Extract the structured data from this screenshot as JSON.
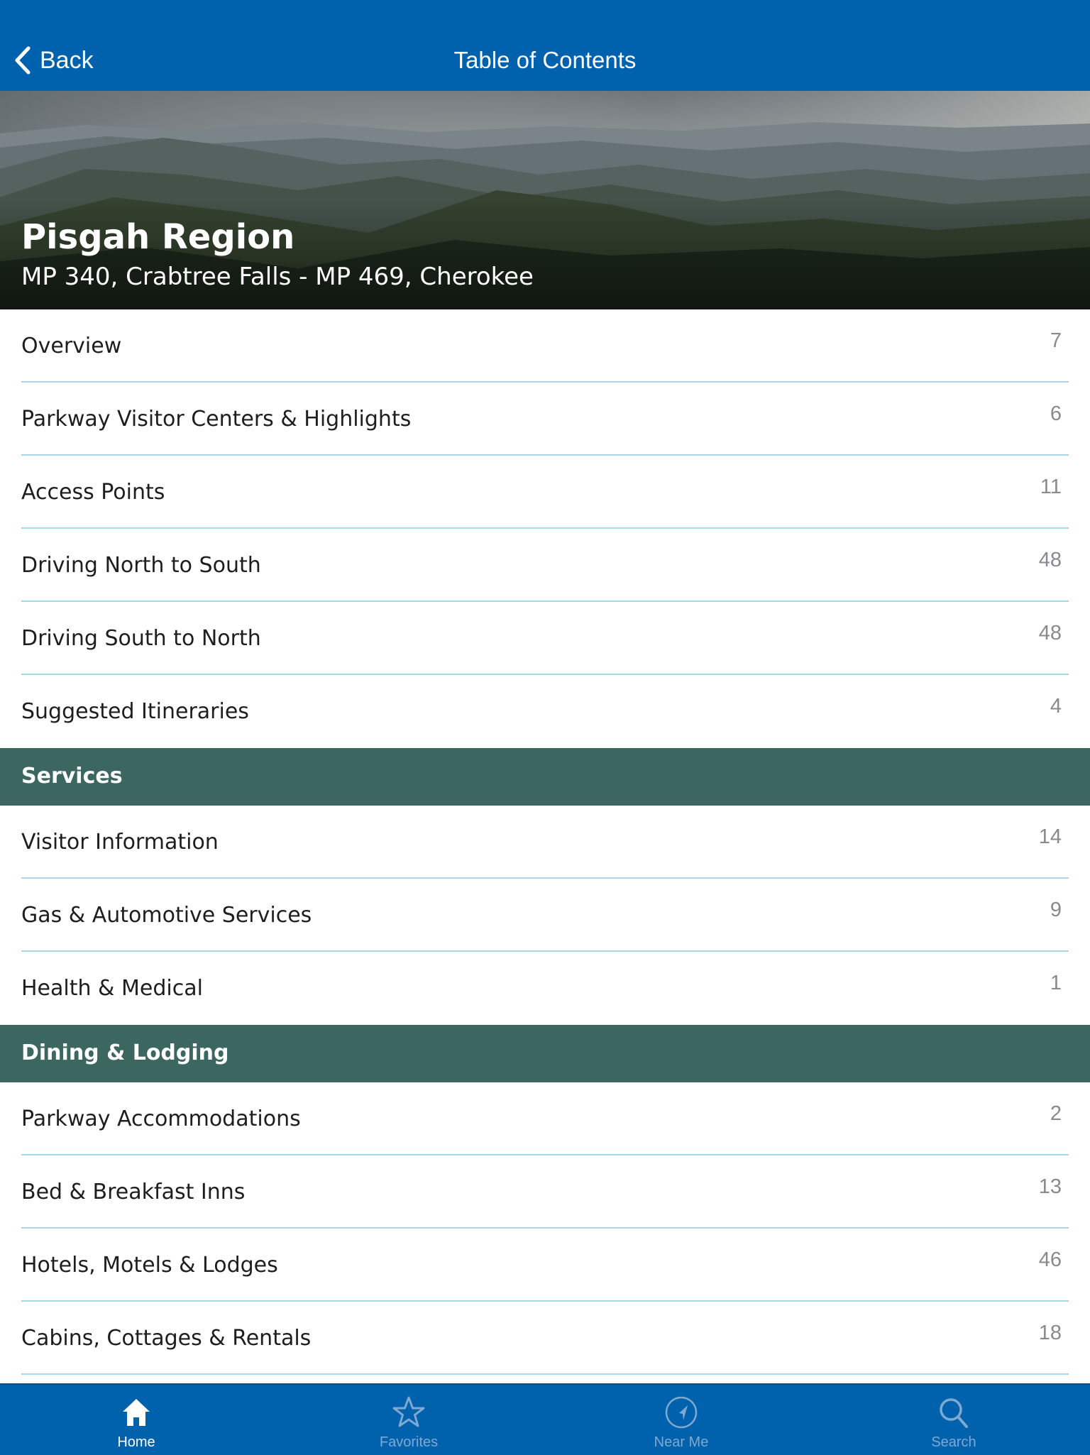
{
  "navbar": {
    "back_label": "Back",
    "title": "Table of Contents"
  },
  "hero": {
    "title": "Pisgah Region",
    "subtitle": "MP 340, Crabtree Falls - MP 469, Cherokee"
  },
  "groups": [
    {
      "header": null,
      "items": [
        {
          "label": "Overview",
          "count": "7"
        },
        {
          "label": "Parkway Visitor Centers & Highlights",
          "count": "6"
        },
        {
          "label": "Access Points",
          "count": "11"
        },
        {
          "label": "Driving North to South",
          "count": "48"
        },
        {
          "label": "Driving South to North",
          "count": "48"
        },
        {
          "label": "Suggested Itineraries",
          "count": "4"
        }
      ]
    },
    {
      "header": "Services",
      "items": [
        {
          "label": "Visitor Information",
          "count": "14"
        },
        {
          "label": "Gas & Automotive Services",
          "count": "9"
        },
        {
          "label": "Health & Medical",
          "count": "1"
        }
      ]
    },
    {
      "header": "Dining & Lodging",
      "items": [
        {
          "label": "Parkway Accommodations",
          "count": "2"
        },
        {
          "label": "Bed & Breakfast Inns",
          "count": "13"
        },
        {
          "label": "Hotels, Motels & Lodges",
          "count": "46"
        },
        {
          "label": "Cabins, Cottages & Rentals",
          "count": "18"
        }
      ]
    }
  ],
  "tabbar": {
    "active": "home",
    "tabs": [
      {
        "id": "home",
        "label": "Home",
        "icon": "home-icon"
      },
      {
        "id": "favorites",
        "label": "Favorites",
        "icon": "star-icon"
      },
      {
        "id": "near-me",
        "label": "Near Me",
        "icon": "location-arrow-icon"
      },
      {
        "id": "search",
        "label": "Search",
        "icon": "search-icon"
      }
    ]
  },
  "colors": {
    "navbar": "#0061ad",
    "section_header": "#3c6760",
    "separator": "#a6d8ec",
    "count_text": "#8a8a8e",
    "tab_inactive": "#7fa9d3"
  }
}
